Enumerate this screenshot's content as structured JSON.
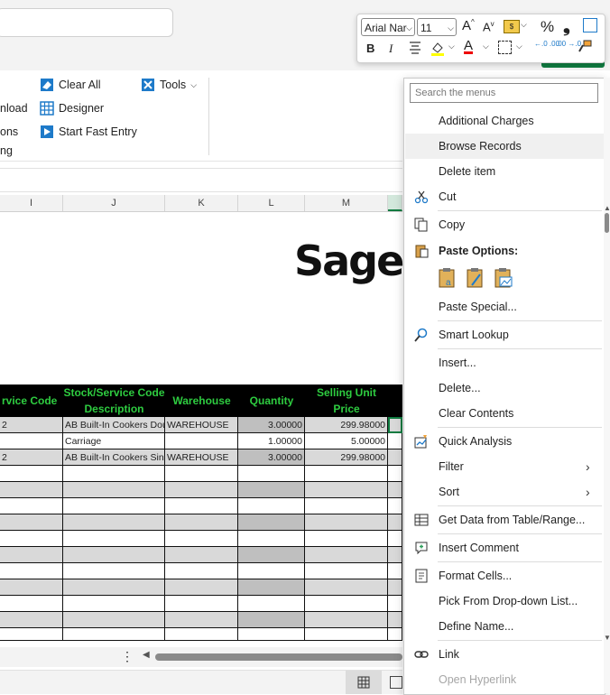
{
  "ribbon": {
    "clear_all": "Clear All",
    "designer": "Designer",
    "start_fast_entry": "Start Fast Entry",
    "tools": "Tools",
    "cut_off_1": "nload",
    "cut_off_2": "ons",
    "cut_off_3": "ng"
  },
  "font_toolbar": {
    "font_name": "Arial Nar",
    "font_size": "11",
    "bold": "B",
    "italic": "I",
    "percent": "%",
    "comma": "❟",
    "dec_increase": "←.0 .00",
    "dec_decrease": ".00 →.0"
  },
  "columns": [
    "I",
    "J",
    "K",
    "L",
    "M"
  ],
  "logo": "Sage",
  "table": {
    "headers": [
      "rvice Code",
      "Stock/Service Code Description",
      "Warehouse",
      "Quantity",
      "Selling Unit Price"
    ],
    "rows": [
      [
        "2",
        "AB Built-In Cookers Doub",
        "WAREHOUSE",
        "3.00000",
        "299.98000"
      ],
      [
        "",
        "Carriage",
        "",
        "1.00000",
        "5.00000"
      ],
      [
        "2",
        "AB Built-In Cookers Singl",
        "WAREHOUSE",
        "3.00000",
        "299.98000"
      ]
    ]
  },
  "context_menu": {
    "search_placeholder": "Search the menus",
    "items": [
      {
        "label": "Additional Charges"
      },
      {
        "label": "Browse Records"
      },
      {
        "label": "Delete item"
      },
      {
        "label": "Cut"
      },
      {
        "label": "Copy"
      },
      {
        "label": "Paste Options:"
      },
      {
        "label": "Paste Special..."
      },
      {
        "label": "Smart Lookup"
      },
      {
        "label": "Insert..."
      },
      {
        "label": "Delete..."
      },
      {
        "label": "Clear Contents"
      },
      {
        "label": "Quick Analysis"
      },
      {
        "label": "Filter"
      },
      {
        "label": "Sort"
      },
      {
        "label": "Get Data from Table/Range..."
      },
      {
        "label": "Insert Comment"
      },
      {
        "label": "Format Cells..."
      },
      {
        "label": "Pick From Drop-down List..."
      },
      {
        "label": "Define Name..."
      },
      {
        "label": "Link"
      },
      {
        "label": "Open Hyperlink"
      }
    ]
  },
  "colors": {
    "header_bg": "#000000",
    "header_text": "#2ecc40",
    "excel_green": "#107c41",
    "row_shade": "#d9d9d9"
  }
}
